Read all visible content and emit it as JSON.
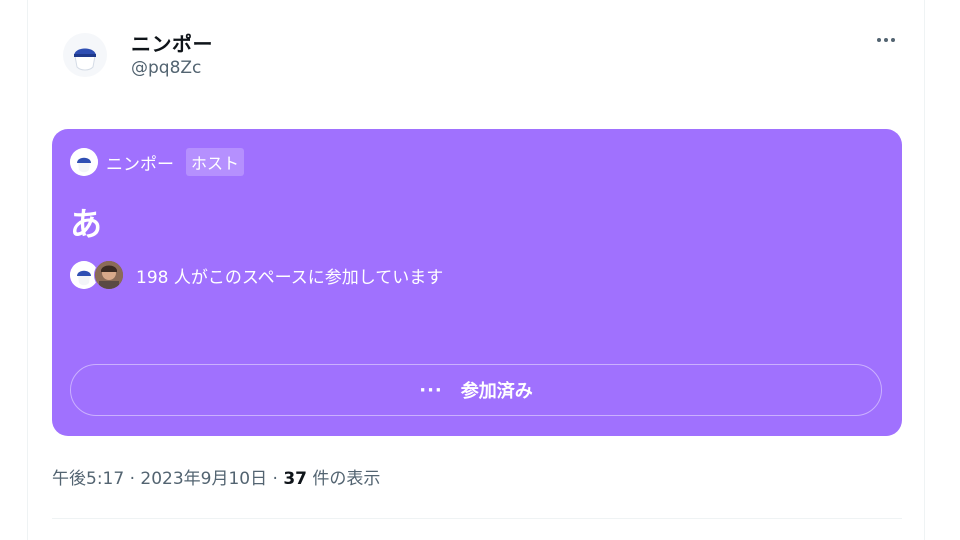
{
  "post": {
    "display_name": "ニンポー",
    "handle": "@pq8Zc",
    "more_icon": "more-horizontal-icon"
  },
  "space_card": {
    "host_name": "ニンポー",
    "host_badge": "ホスト",
    "title": "あ",
    "listener_text": "198 人がこのスペースに参加しています",
    "joined_button_label": "参加済み",
    "joined_button_icon": "more-dots-icon",
    "background_color": "#a071fe"
  },
  "meta": {
    "time": "午後5:17",
    "sep1": "·",
    "date": "2023年9月10日",
    "sep2": "·",
    "views_count": "37",
    "views_suffix": "件の表示"
  }
}
